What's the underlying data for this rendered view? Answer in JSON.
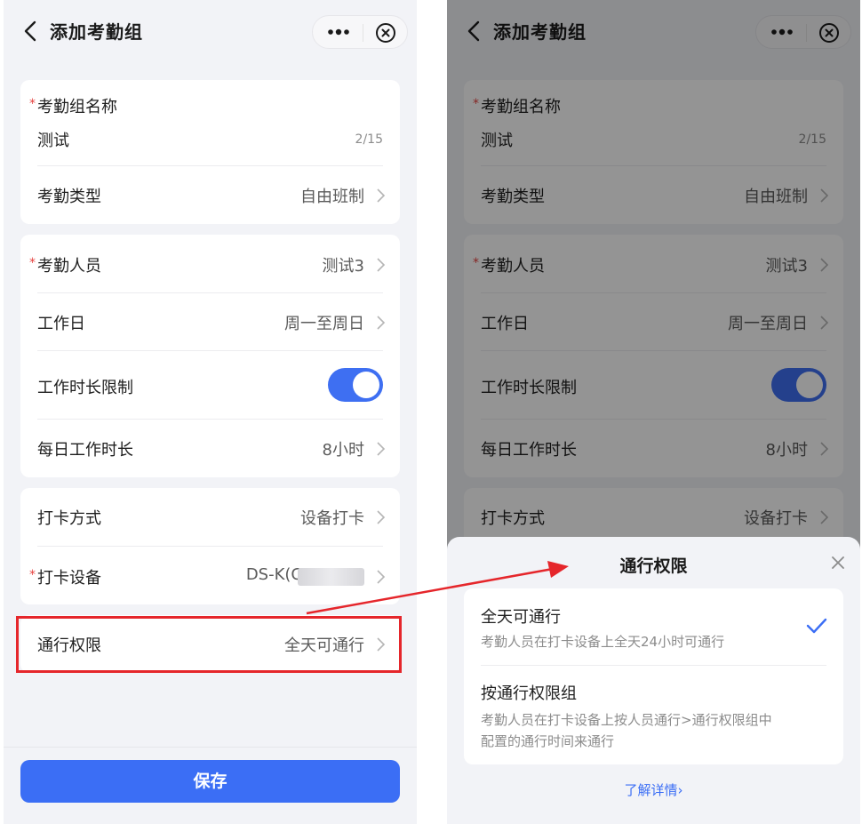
{
  "left": {
    "header": {
      "title": "添加考勤组"
    },
    "group_card": {
      "name_label": "考勤组名称",
      "name_value": "测试",
      "name_counter": "2/15",
      "type_label": "考勤类型",
      "type_value": "自由班制"
    },
    "people_card": {
      "people_label": "考勤人员",
      "people_value": "测试3",
      "workday_label": "工作日",
      "workday_value": "周一至周日",
      "limit_label": "工作时长限制",
      "limit_on": true,
      "daily_label": "每日工作时长",
      "daily_value": "8小时"
    },
    "clock_card": {
      "method_label": "打卡方式",
      "method_value": "设备打卡",
      "device_label": "打卡设备",
      "device_value": "DS-K(C"
    },
    "access_row": {
      "label": "通行权限",
      "value": "全天可通行"
    },
    "save_label": "保存"
  },
  "right": {
    "header": {
      "title": "添加考勤组"
    },
    "group_card": {
      "name_label": "考勤组名称",
      "name_value": "测试",
      "name_counter": "2/15",
      "type_label": "考勤类型",
      "type_value": "自由班制"
    },
    "people_card": {
      "people_label": "考勤人员",
      "people_value": "测试3",
      "workday_label": "工作日",
      "workday_value": "周一至周日",
      "limit_label": "工作时长限制",
      "daily_label": "每日工作时长",
      "daily_value": "8小时"
    },
    "clock_card": {
      "method_label": "打卡方式",
      "method_value": "设备打卡"
    },
    "sheet": {
      "title": "通行权限",
      "options": [
        {
          "title": "全天可通行",
          "desc": "考勤人员在打卡设备上全天24小时可通行",
          "selected": true
        },
        {
          "title": "按通行权限组",
          "desc": "考勤人员在打卡设备上按人员通行>通行权限组中配置的通行时间来通行",
          "selected": false
        }
      ],
      "learn_more": "了解详情›"
    }
  },
  "colors": {
    "accent": "#3b6ef5",
    "required": "#e64340",
    "annotation": "#e5262b"
  },
  "icons": [
    "back-arrow-icon",
    "more-dots-icon",
    "close-circle-icon",
    "chevron-right-icon",
    "close-icon",
    "checkmark-icon"
  ]
}
